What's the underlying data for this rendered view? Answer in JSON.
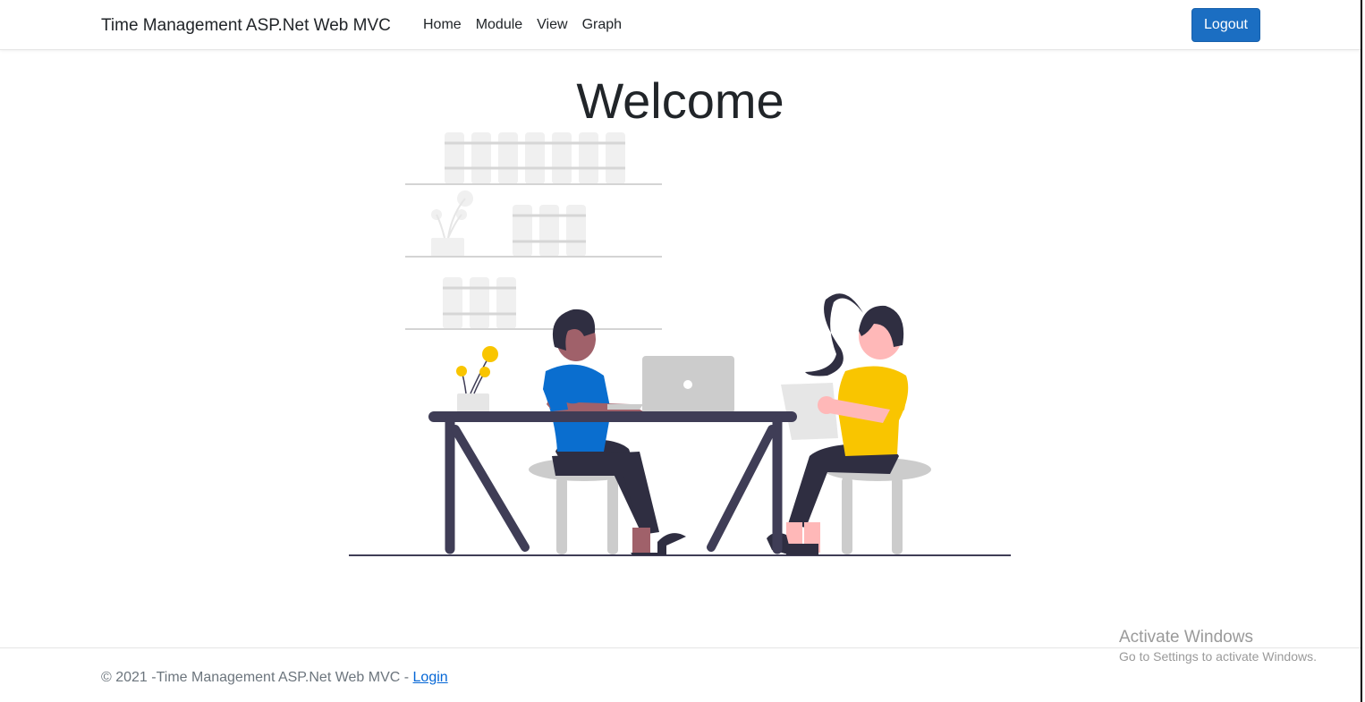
{
  "navbar": {
    "brand": "Time Management ASP.Net Web MVC",
    "links": [
      {
        "label": "Home"
      },
      {
        "label": "Module"
      },
      {
        "label": "View"
      },
      {
        "label": "Graph"
      }
    ],
    "logout_label": "Logout"
  },
  "main": {
    "heading": "Welcome"
  },
  "footer": {
    "text": "© 2021 -Time Management ASP.Net Web MVC - ",
    "link_label": "Login"
  },
  "watermark": {
    "title": "Activate Windows",
    "subtitle": "Go to Settings to activate Windows."
  },
  "colors": {
    "primary_button": "#1b6ec2",
    "link": "#0366d6",
    "illustration_dark": "#3f3d56",
    "illustration_blue": "#0a6ecf",
    "illustration_yellow": "#f9c500"
  }
}
